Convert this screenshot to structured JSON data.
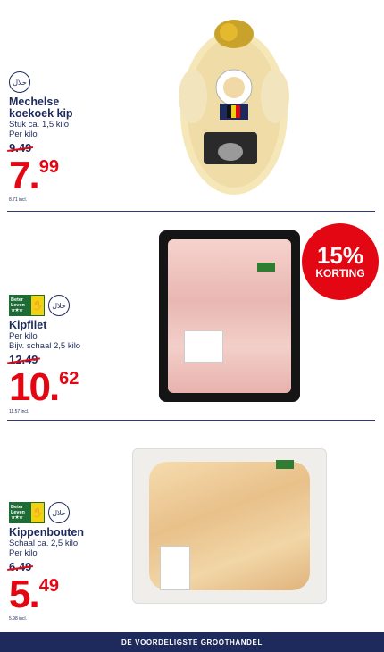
{
  "products": [
    {
      "title_lines": [
        "Mechelse",
        "koekoek kip"
      ],
      "details": [
        "Stuk ca. 1,5 kilo",
        "Per kilo"
      ],
      "old_price": "9.49",
      "price_int": "7.",
      "price_dec": "99",
      "incl": "8.71 incl.",
      "badges": [
        "halal"
      ],
      "halal_text": "حلال"
    },
    {
      "title_lines": [
        "Kipfilet"
      ],
      "details": [
        "Per kilo",
        "Bijv. schaal 2,5 kilo"
      ],
      "old_price": "12.49",
      "price_int": "10.",
      "price_dec": "62",
      "incl": "11.57 incl.",
      "badges": [
        "beter-leven",
        "halal"
      ],
      "halal_text": "حلال",
      "beter_leven": "Beter Leven",
      "beter_leven_stars": "★★★"
    },
    {
      "title_lines": [
        "Kippenbouten"
      ],
      "details": [
        "Schaal ca. 2,5 kilo",
        "Per kilo"
      ],
      "old_price": "6.49",
      "price_int": "5.",
      "price_dec": "49",
      "incl": "5.98 incl.",
      "badges": [
        "beter-leven",
        "halal"
      ],
      "halal_text": "حلال",
      "beter_leven": "Beter Leven",
      "beter_leven_stars": "★★★"
    }
  ],
  "discount": {
    "percent": "15%",
    "label": "KORTING"
  },
  "footer": {
    "text": "DE VOORDELIGSTE GROOTHANDEL"
  },
  "colors": {
    "navy": "#1d2a5b",
    "red": "#e30613",
    "green": "#1d6b35"
  }
}
